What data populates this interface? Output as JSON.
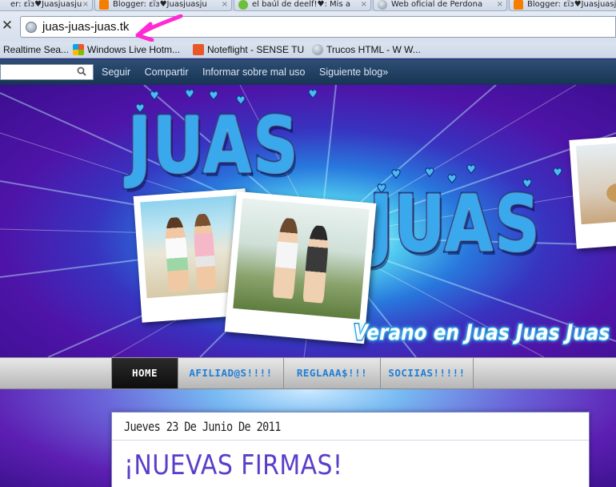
{
  "browser": {
    "tabs": [
      {
        "label": "er: ɛïɜ♥Juasjuasju",
        "favicon": "blogger-icon",
        "color": "#c8d3e3"
      },
      {
        "label": "Blogger: ɛïɜ♥Juasjuasju",
        "favicon": "blogger-icon",
        "color": "#f57d00"
      },
      {
        "label": "el baúl de deelf!♥: Mis a",
        "favicon": "green-leaf-icon",
        "color": "#6cbf3a"
      },
      {
        "label": "Web oficial de Perdona",
        "favicon": "globe-icon",
        "color": "#8b97a6"
      },
      {
        "label": "Blogger: ɛïɜ♥Juasjuasj",
        "favicon": "blogger-icon",
        "color": "#f57d00"
      }
    ],
    "tab_close": "×",
    "stop_symbol": "✕",
    "url": "juas-juas-juas.tk",
    "bookmarks": [
      {
        "label": "Realtime Sea...",
        "icon": "none"
      },
      {
        "label": "Windows Live Hotm...",
        "icon": "windows-logo-icon"
      },
      {
        "label": "Noteflight - SENSE TU",
        "icon": "noteflight-icon"
      },
      {
        "label": "Trucos HTML - W W...",
        "icon": "globe-icon"
      }
    ]
  },
  "navbar": {
    "links": [
      "Seguir",
      "Compartir",
      "Informar sobre mal uso",
      "Siguiente blog»"
    ]
  },
  "header": {
    "word_top": "JUAS",
    "word_bottom": "JUAS",
    "tagline": "Verano en Juas Juas Juas"
  },
  "menu": {
    "items": [
      "HOME",
      "AFILIAD@S!!!!",
      "REGLAAA$!!!",
      "SOCIIAS!!!!!"
    ],
    "active_index": 0
  },
  "post": {
    "date": "Jueves 23 De Junio De 2011",
    "title": "¡NUEVAS FIRMAS!"
  },
  "colors": {
    "annotation_arrow": "#ff2ad4",
    "menu_link": "#1f7fd6",
    "post_title": "#5b3ec8"
  }
}
